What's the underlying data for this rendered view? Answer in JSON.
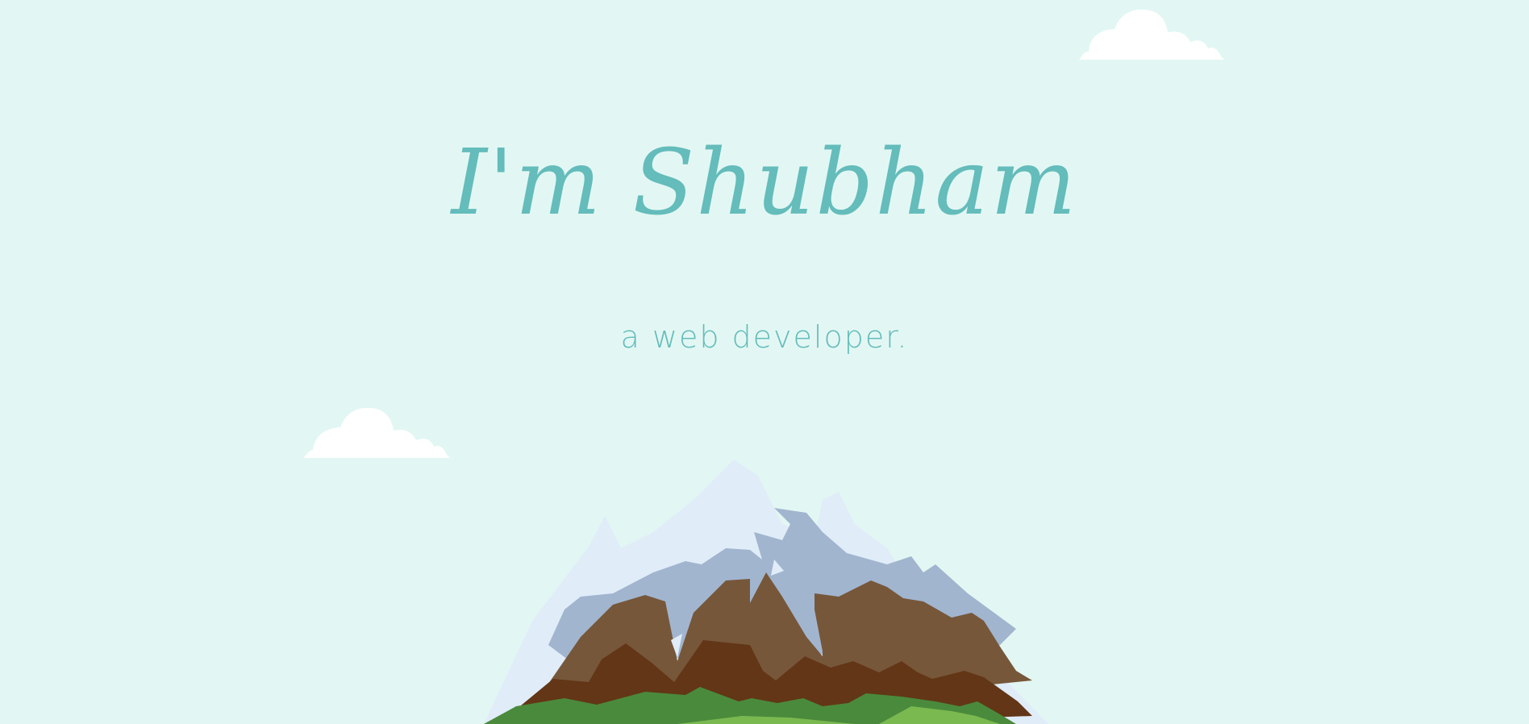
{
  "hero": {
    "title": "I'm Shubham",
    "subtitle": "a web developer."
  },
  "colors": {
    "background": "#e2f7f3",
    "text_accent": "#64bcbb",
    "cloud": "#ffffff",
    "snow": "#e0ecf8",
    "rock_shadow": "#a1b5cf",
    "earth_light": "#77573a",
    "earth_dark": "#623616",
    "grass_dark": "#4a8a3c",
    "grass_light": "#7ab850"
  }
}
